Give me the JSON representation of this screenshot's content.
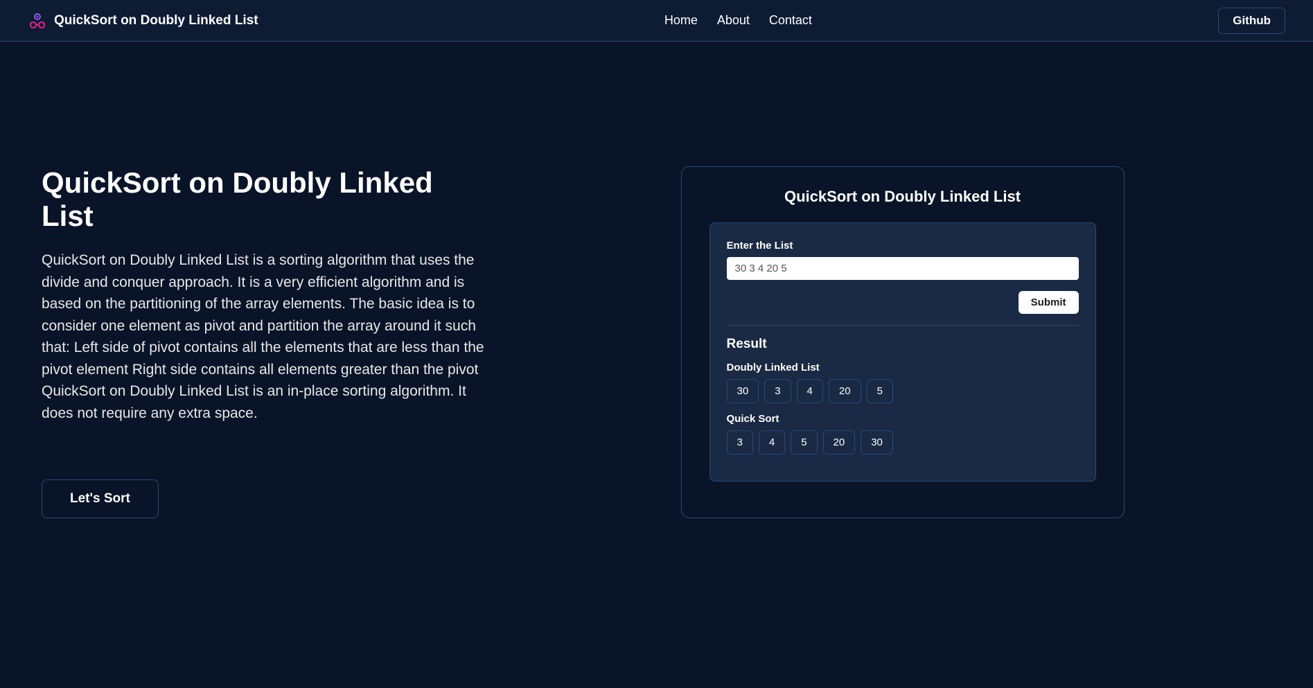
{
  "navbar": {
    "title": "QuickSort on Doubly Linked List",
    "links": {
      "home": "Home",
      "about": "About",
      "contact": "Contact"
    },
    "github": "Github"
  },
  "hero": {
    "title": "QuickSort on Doubly Linked List",
    "description": "QuickSort on Doubly Linked List is a sorting algorithm that uses the divide and conquer approach. It is a very efficient algorithm and is based on the partitioning of the array elements. The basic idea is to consider one element as pivot and partition the array around it such that: Left side of pivot contains all the elements that are less than the pivot element Right side contains all elements greater than the pivot QuickSort on Doubly Linked List is an in-place sorting algorithm. It does not require any extra space.",
    "cta": "Let's Sort"
  },
  "card": {
    "title": "QuickSort on Doubly Linked List",
    "form": {
      "label": "Enter the List",
      "value": "30 3 4 20 5",
      "submit": "Submit"
    },
    "result": {
      "title": "Result",
      "doubly_label": "Doubly Linked List",
      "doubly_values": [
        "30",
        "3",
        "4",
        "20",
        "5"
      ],
      "sorted_label": "Quick Sort",
      "sorted_values": [
        "3",
        "4",
        "5",
        "20",
        "30"
      ]
    }
  }
}
